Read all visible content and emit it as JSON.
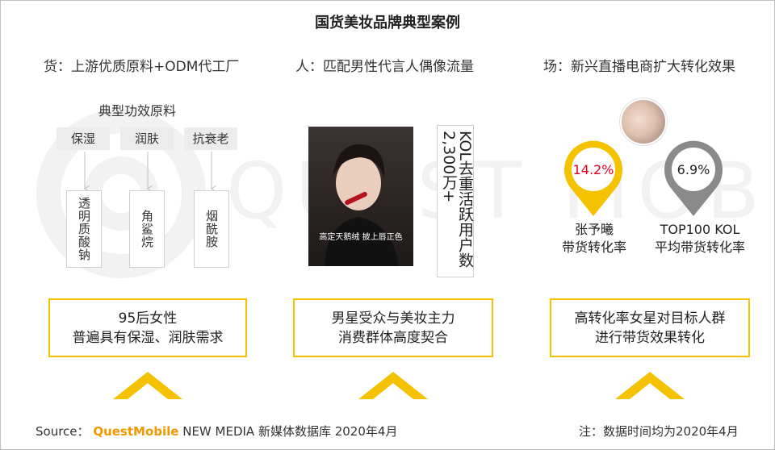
{
  "title": "国货美妆品牌典型案例",
  "columns": [
    {
      "header": "货：上游优质原料+ODM代工厂"
    },
    {
      "header": "人：匹配男性代言人偶像流量"
    },
    {
      "header": "场：新兴直播电商扩大转化效果"
    }
  ],
  "left": {
    "subtitle": "典型功效原料",
    "tags": [
      "保湿",
      "润肤",
      "抗衰老"
    ],
    "ingredients": [
      "透明质酸钠",
      "角鲨烷",
      "烟酰胺"
    ]
  },
  "middle": {
    "photo_caption": "高定天鹅绒 披上唇正色",
    "kol_text": "KOL去重活跃用户数2,300万+"
  },
  "right": {
    "pins": [
      {
        "value": "14.2%",
        "caption_line1": "张予曦",
        "caption_line2": "带货转化率",
        "color": "#f5c200",
        "value_color": "#e0001b"
      },
      {
        "value": "6.9%",
        "caption_line1": "TOP100 KOL",
        "caption_line2": "平均带货转化率",
        "color": "#8a8a8a",
        "value_color": "#222222"
      }
    ]
  },
  "boxes": [
    {
      "line1": "95后女性",
      "line2": "普遍具有保湿、润肤需求"
    },
    {
      "line1": "男星受众与美妆主力",
      "line2": "消费群体高度契合"
    },
    {
      "line1": "高转化率女星对目标人群",
      "line2": "进行带货效果转化"
    }
  ],
  "footer": {
    "source_label": "Source：",
    "brand": "QuestMobile",
    "source_rest": "NEW MEDIA 新媒体数据库 2020年4月",
    "note": "注：数据时间均为2020年4月"
  },
  "colors": {
    "accent": "#f5c200",
    "brand": "#f39800",
    "highlight": "#e0001b"
  }
}
